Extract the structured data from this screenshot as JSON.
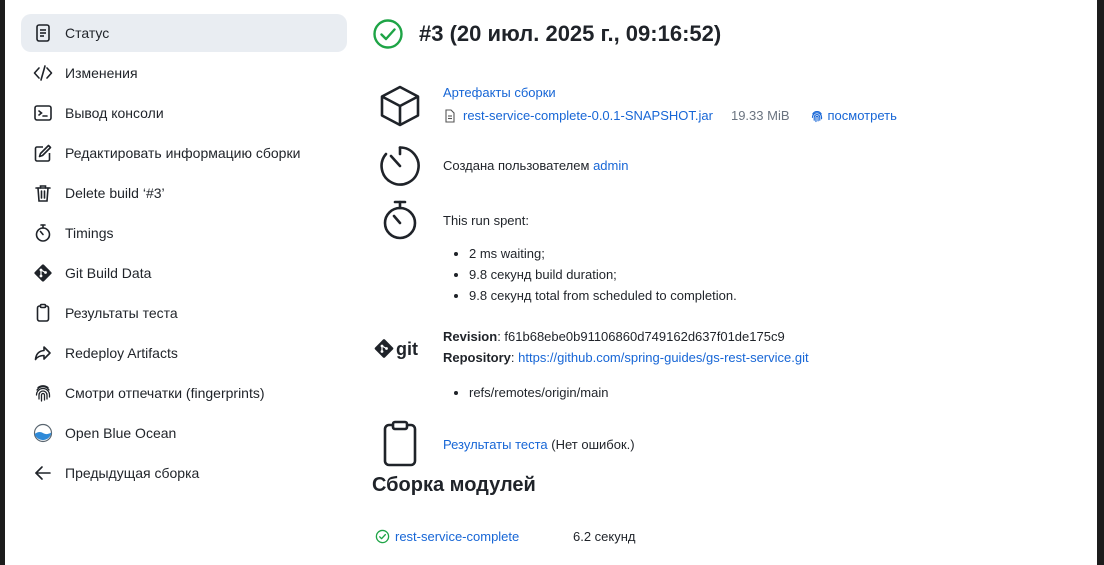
{
  "sidebar": {
    "items": [
      {
        "label": "Статус",
        "icon": "document-icon",
        "active": true
      },
      {
        "label": "Изменения",
        "icon": "code-icon"
      },
      {
        "label": "Вывод консоли",
        "icon": "terminal-icon"
      },
      {
        "label": "Редактировать информацию сборки",
        "icon": "edit-icon"
      },
      {
        "label": "Delete build ‘#3’",
        "icon": "trash-icon"
      },
      {
        "label": "Timings",
        "icon": "stopwatch-icon"
      },
      {
        "label": "Git Build Data",
        "icon": "git-icon"
      },
      {
        "label": "Результаты теста",
        "icon": "clipboard-icon"
      },
      {
        "label": "Redeploy Artifacts",
        "icon": "share-icon"
      },
      {
        "label": "Смотри отпечатки (fingerprints)",
        "icon": "fingerprint-icon"
      },
      {
        "label": "Open Blue Ocean",
        "icon": "blue-ocean-icon"
      },
      {
        "label": "Предыдущая сборка",
        "icon": "arrow-left-icon"
      }
    ]
  },
  "header": {
    "title": "#3 (20 июл. 2025 г., 09:16:52)",
    "status_color": "#1ea446"
  },
  "artifacts": {
    "heading": "Артефакты сборки",
    "file": "rest-service-complete-0.0.1-SNAPSHOT.jar",
    "size": "19.33 MiB",
    "view_label": "посмотреть"
  },
  "created_by": {
    "prefix": "Создана пользователем",
    "user": "admin"
  },
  "timing": {
    "heading": "This run spent:",
    "items": [
      "2 ms waiting;",
      "9.8 секунд build duration;",
      "9.8 секунд total from scheduled to completion."
    ]
  },
  "git": {
    "revision_label": "Revision",
    "revision": "f61b68ebe0b91106860d749162d637f01de175c9",
    "repository_label": "Repository",
    "repository": "https://github.com/spring-guides/gs-rest-service.git",
    "branches": [
      "refs/remotes/origin/main"
    ],
    "logo_text": "git"
  },
  "tests": {
    "link": "Результаты теста",
    "suffix": "(Нет ошибок.)"
  },
  "modules": {
    "title": "Сборка модулей",
    "rows": [
      {
        "name": "rest-service-complete",
        "time": "6.2 секунд"
      }
    ]
  },
  "colors": {
    "link": "#1766d6",
    "success": "#1ea446",
    "active_bg": "#e9edf2"
  }
}
